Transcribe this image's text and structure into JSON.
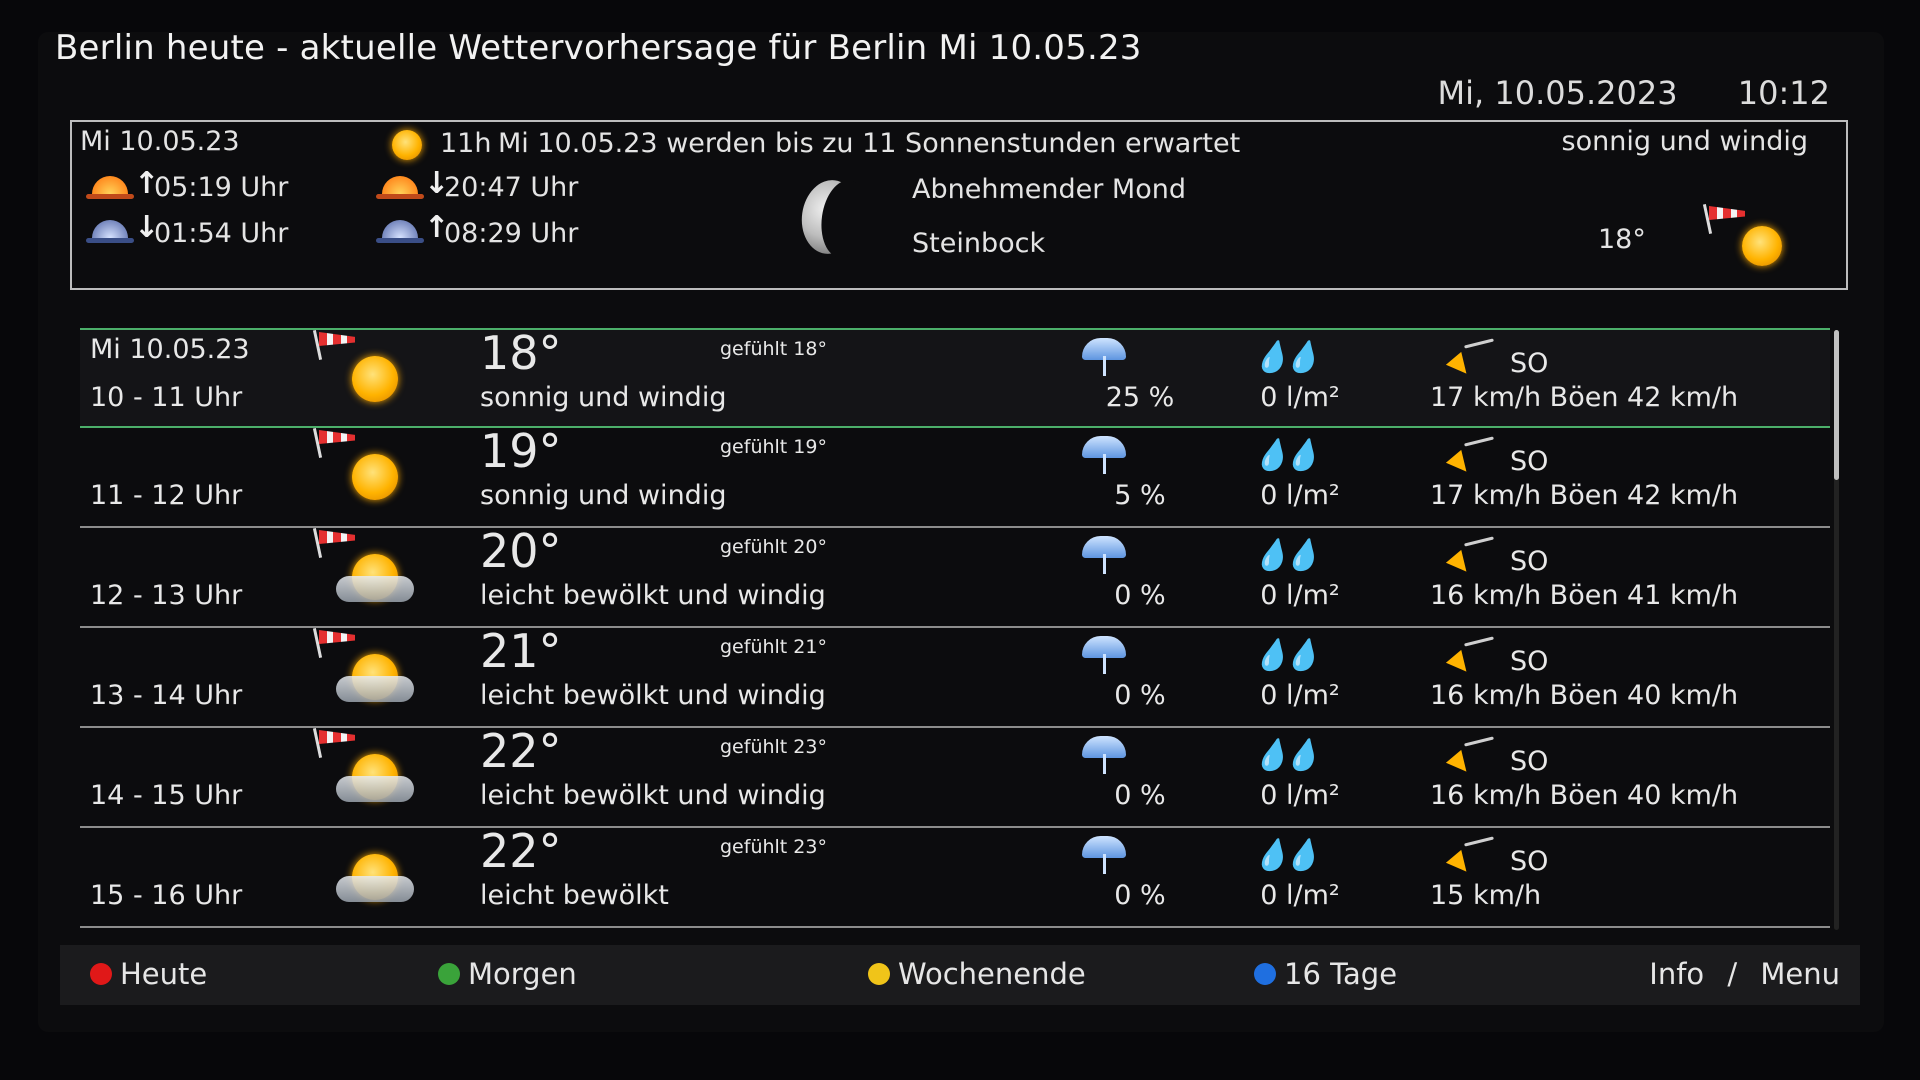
{
  "title": "Berlin heute - aktuelle Wettervorhersage für Berlin Mi 10.05.23",
  "header": {
    "date": "Mi, 10.05.2023",
    "time": "10:12"
  },
  "summary": {
    "date": "Mi 10.05.23",
    "sun_hours": "11h",
    "sun_text": "Mi 10.05.23 werden bis zu 11 Sonnenstunden erwartet",
    "condition": "sonnig und windig",
    "sunrise": "05:19 Uhr",
    "sunset": "20:47 Uhr",
    "moonset": "01:54 Uhr",
    "moonrise": "08:29 Uhr",
    "moon_phase": "Abnehmender Mond",
    "zodiac": "Steinbock",
    "temp": "18°"
  },
  "rows": [
    {
      "date": "Mi 10.05.23",
      "hour": "10 - 11 Uhr",
      "temp": "18°",
      "feel": "gefühlt 18°",
      "cond": "sonnig und windig",
      "prob": "25 %",
      "rain": "0 l/m²",
      "dir": "SO",
      "speed": "17 km/h Böen 42 km/h"
    },
    {
      "date": "",
      "hour": "11 - 12 Uhr",
      "temp": "19°",
      "feel": "gefühlt 19°",
      "cond": "sonnig und windig",
      "prob": "5 %",
      "rain": "0 l/m²",
      "dir": "SO",
      "speed": "17 km/h Böen 42 km/h"
    },
    {
      "date": "",
      "hour": "12 - 13 Uhr",
      "temp": "20°",
      "feel": "gefühlt 20°",
      "cond": "leicht bewölkt und windig",
      "prob": "0 %",
      "rain": "0 l/m²",
      "dir": "SO",
      "speed": "16 km/h Böen 41 km/h"
    },
    {
      "date": "",
      "hour": "13 - 14 Uhr",
      "temp": "21°",
      "feel": "gefühlt 21°",
      "cond": "leicht bewölkt und windig",
      "prob": "0 %",
      "rain": "0 l/m²",
      "dir": "SO",
      "speed": "16 km/h Böen 40 km/h"
    },
    {
      "date": "",
      "hour": "14 - 15 Uhr",
      "temp": "22°",
      "feel": "gefühlt 23°",
      "cond": "leicht bewölkt und windig",
      "prob": "0 %",
      "rain": "0 l/m²",
      "dir": "SO",
      "speed": "16 km/h Böen 40 km/h"
    },
    {
      "date": "",
      "hour": "15 - 16 Uhr",
      "temp": "22°",
      "feel": "gefühlt 23°",
      "cond": "leicht bewölkt",
      "prob": "0 %",
      "rain": "0 l/m²",
      "dir": "SO",
      "speed": "15 km/h"
    }
  ],
  "footer": {
    "red": "Heute",
    "green": "Morgen",
    "yellow": "Wochenende",
    "blue": "16 Tage",
    "info": "Info",
    "sep": "/",
    "menu": "Menu",
    "colors": {
      "red": "#e01818",
      "green": "#3aa33a",
      "yellow": "#f0c419",
      "blue": "#1f6fe0"
    }
  }
}
